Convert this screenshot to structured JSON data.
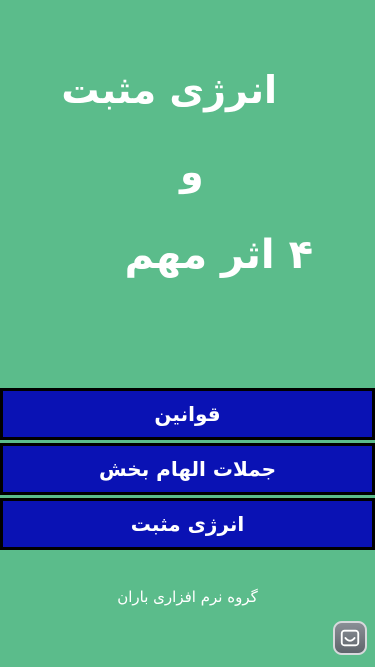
{
  "title": {
    "line1": "انرژی مثبت",
    "line2": "و",
    "line3": "۴ اثر مهم"
  },
  "menu": {
    "items": [
      {
        "label": "قوانین"
      },
      {
        "label": "جملات الهام بخش"
      },
      {
        "label": "انرژی مثبت"
      }
    ]
  },
  "footer": {
    "credit": "گروه نرم افزاری باران"
  },
  "icons": {
    "corner": "app-badge-icon"
  },
  "colors": {
    "background": "#5bbc8b",
    "button": "#0a12b4",
    "button_border": "#000000",
    "text": "#ffffff"
  }
}
